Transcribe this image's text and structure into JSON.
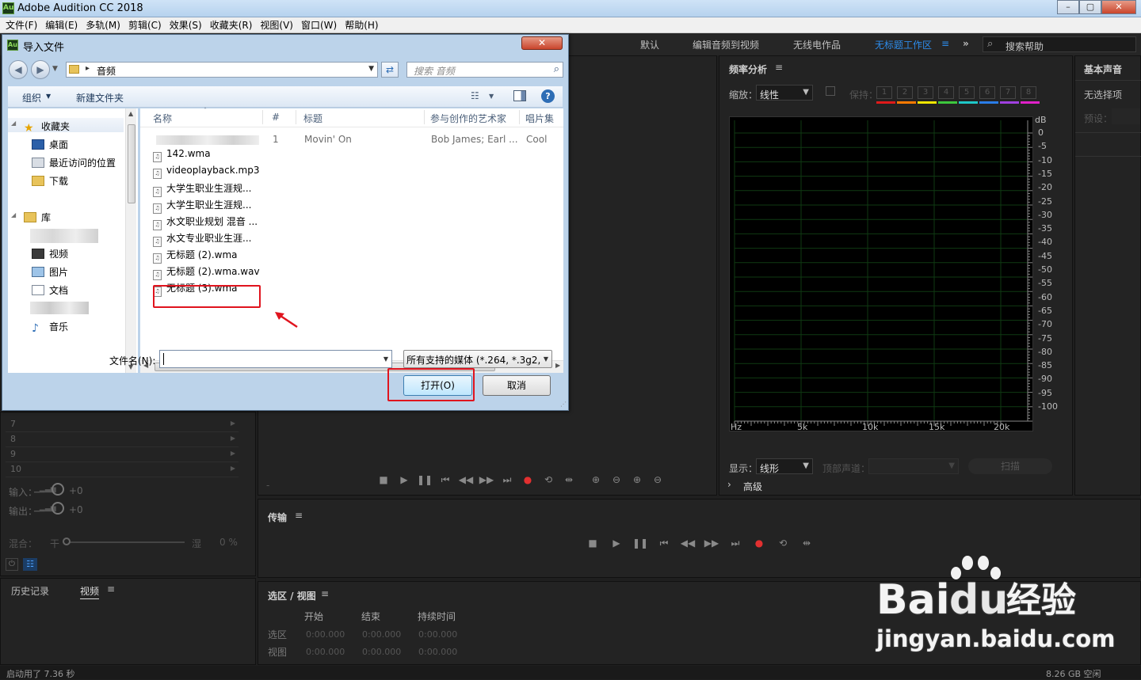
{
  "app": {
    "title": "Adobe Audition CC 2018",
    "icon_label": "Au",
    "window_buttons": [
      "–",
      "▢",
      "✕"
    ]
  },
  "menu": [
    "文件(F)",
    "编辑(E)",
    "多轨(M)",
    "剪辑(C)",
    "效果(S)",
    "收藏夹(R)",
    "视图(V)",
    "窗口(W)",
    "帮助(H)"
  ],
  "workspaces": {
    "items": [
      "默认",
      "编辑音频到视频",
      "无线电作品",
      "无标题工作区"
    ],
    "active": "无标题工作区",
    "overflow": "»",
    "search_placeholder": "搜索帮助"
  },
  "freq_panel": {
    "title": "频率分析",
    "zoom_label": "缩放：",
    "zoom_value": "线性",
    "hold_label": "保持：",
    "hold_slots": [
      "1",
      "2",
      "3",
      "4",
      "5",
      "6",
      "7",
      "8"
    ],
    "hold_colors": [
      "#e01a1a",
      "#ff7a00",
      "#f2e600",
      "#3dc83d",
      "#1ec8c8",
      "#2a7de8",
      "#a040e0",
      "#e020c8"
    ],
    "db_label": "dB",
    "db_ticks": [
      "0",
      "-5",
      "-10",
      "-15",
      "-20",
      "-25",
      "-30",
      "-35",
      "-40",
      "-45",
      "-50",
      "-55",
      "-60",
      "-65",
      "-70",
      "-75",
      "-80",
      "-85",
      "-90",
      "-95",
      "-100"
    ],
    "hz_ticks": [
      "Hz",
      "5k",
      "10k",
      "15k",
      "20k"
    ],
    "display_label": "显示：",
    "display_value": "线形",
    "channel_label": "顶部声道：",
    "scan_button": "扫描",
    "advanced": "高级"
  },
  "essential_sound": {
    "title": "基本声音",
    "no_selection": "无选择项",
    "preset_label": "预设："
  },
  "mixer": {
    "rows": [
      "7",
      "8",
      "9",
      "10"
    ],
    "input_label": "输入：",
    "input_value": "+0",
    "output_label": "输出：",
    "output_value": "+0",
    "mix_label": "混合：",
    "mix_dry": "干",
    "mix_wet": "湿",
    "mix_value": "0 %"
  },
  "history_panel": {
    "tabs": [
      "历史记录",
      "视频"
    ],
    "active": "视频"
  },
  "transport": {
    "title": "传输"
  },
  "selection_view": {
    "title": "选区 / 视图",
    "columns": [
      "开始",
      "结束",
      "持续时间"
    ],
    "rows": [
      {
        "label": "选区",
        "values": [
          "0:00.000",
          "0:00.000",
          "0:00.000"
        ]
      },
      {
        "label": "视图",
        "values": [
          "0:00.000",
          "0:00.000",
          "0:00.000"
        ]
      }
    ]
  },
  "status": {
    "left": "启动用了 7.36 秒",
    "right": "8.26 GB 空闲"
  },
  "dialog": {
    "title": "导入文件",
    "close": "✕",
    "breadcrumb": "音频",
    "search_placeholder": "搜索 音频",
    "toolbar_organize": "组织",
    "toolbar_new_folder": "新建文件夹",
    "nav": {
      "favorites": "收藏夹",
      "desktop": "桌面",
      "recent": "最近访问的位置",
      "downloads": "下载",
      "libraries": "库",
      "videos": "视频",
      "pictures": "图片",
      "documents": "文档",
      "music": "音乐"
    },
    "columns": [
      "名称",
      "#",
      "标题",
      "参与创作的艺术家",
      "唱片集"
    ],
    "first_row": {
      "num": "1",
      "title": "Movin' On",
      "artist": "Bob James; Earl ...",
      "album": "Cool"
    },
    "files": [
      "142.wma",
      "videoplayback.mp3",
      "大学生职业生涯规...",
      "大学生职业生涯规...",
      "水文职业规划 混音 ...",
      "水文专业职业生涯...",
      "无标题 (2).wma",
      "无标题 (2).wma.wav",
      "无标题 (3).wma"
    ],
    "highlighted_file": "无标题 (2).wma",
    "scroll_thumb": "III",
    "filename_label": "文件名(N):",
    "filename_value": "",
    "filetype_value": "所有支持的媒体 (*.264, *.3g2,",
    "open_button": "打开(O)",
    "cancel_button": "取消"
  },
  "watermark": {
    "brand": "Bai",
    "brand2": "du",
    "cn": "经验",
    "url": "jingyan.baidu.com"
  }
}
